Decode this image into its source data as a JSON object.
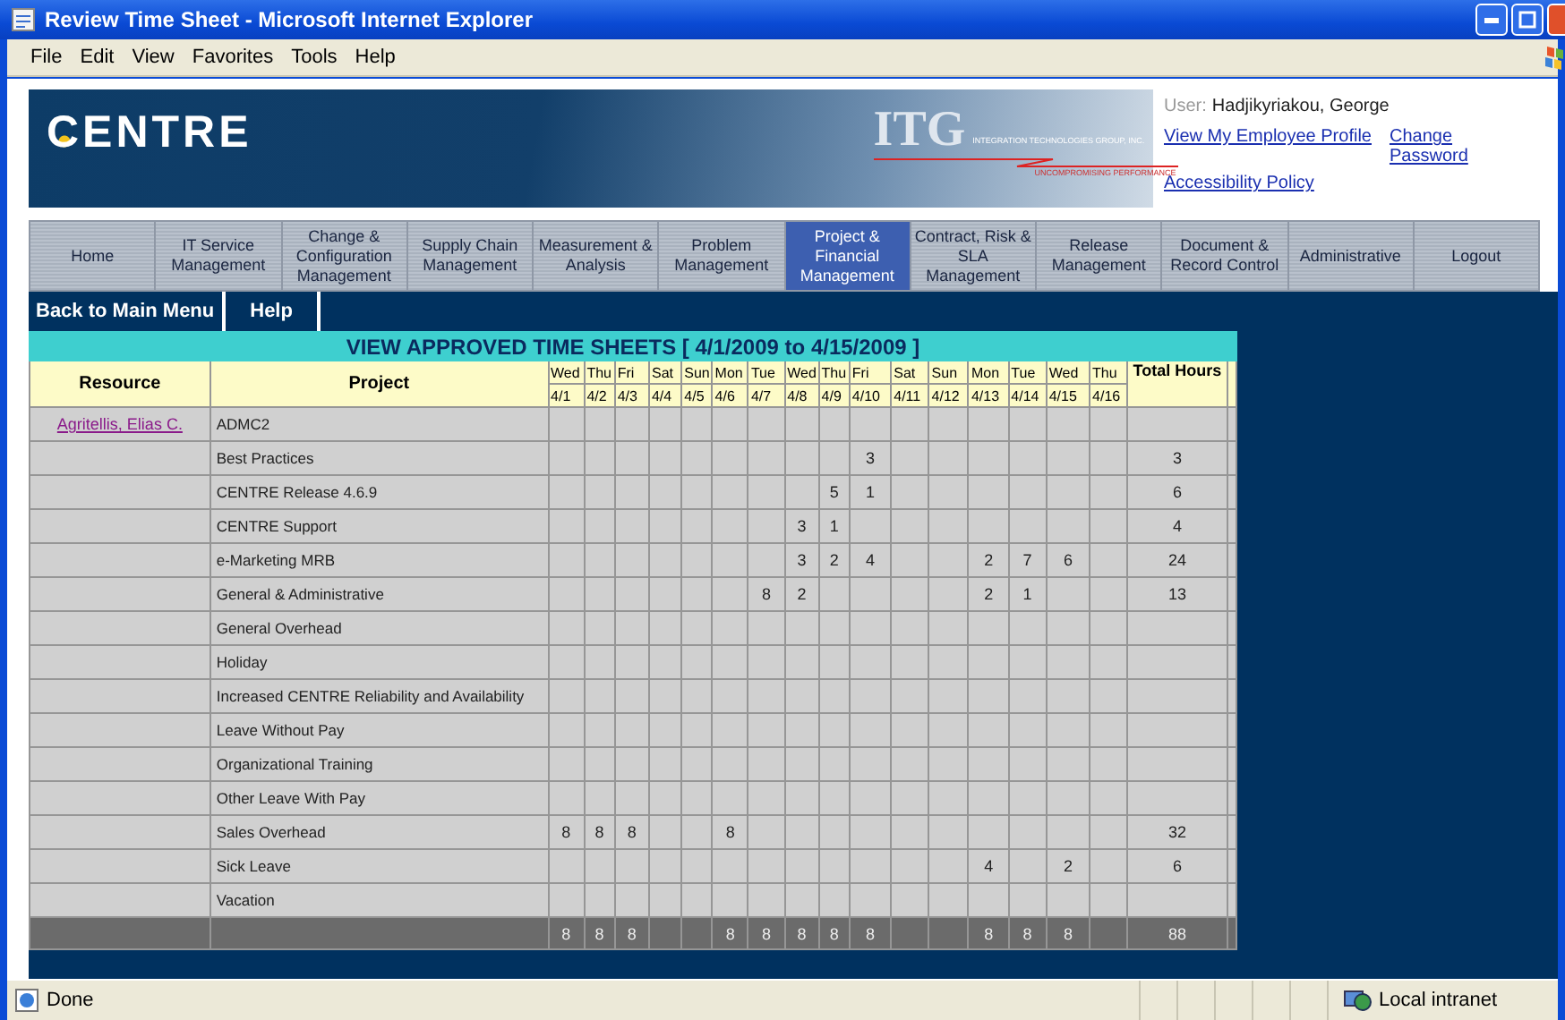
{
  "window": {
    "title": "Review Time Sheet - Microsoft Internet Explorer"
  },
  "menu": [
    "File",
    "Edit",
    "View",
    "Favorites",
    "Tools",
    "Help"
  ],
  "banner": {
    "logo": "CENTRE",
    "partner_logo": "ITG",
    "partner_name": "INTEGRATION TECHNOLOGIES GROUP, INC.",
    "partner_tagline": "UNCOMPROMISING PERFORMANCE"
  },
  "user": {
    "label": "User:",
    "name": "Hadjikyriakou, George",
    "links": [
      "View My Employee Profile",
      "Change Password",
      "Accessibility Policy"
    ]
  },
  "nav": [
    {
      "label": "Home",
      "selected": false
    },
    {
      "label": "IT Service Management",
      "selected": false
    },
    {
      "label": "Change & Configuration Management",
      "selected": false
    },
    {
      "label": "Supply Chain Management",
      "selected": false
    },
    {
      "label": "Measurement & Analysis",
      "selected": false
    },
    {
      "label": "Problem Management",
      "selected": false
    },
    {
      "label": "Project & Financial Management",
      "selected": true
    },
    {
      "label": "Contract, Risk & SLA Management",
      "selected": false
    },
    {
      "label": "Release Management",
      "selected": false
    },
    {
      "label": "Document & Record Control",
      "selected": false
    },
    {
      "label": "Administrative",
      "selected": false
    },
    {
      "label": "Logout",
      "selected": false
    }
  ],
  "sub_nav": [
    "Back to Main Menu",
    "Help"
  ],
  "table": {
    "title": "VIEW APPROVED TIME SHEETS [ 4/1/2009 to 4/15/2009 ]",
    "columns": {
      "resource": "Resource",
      "project": "Project",
      "total": "Total Hours"
    },
    "days": [
      {
        "day": "Wed",
        "date": "4/1"
      },
      {
        "day": "Thu",
        "date": "4/2"
      },
      {
        "day": "Fri",
        "date": "4/3"
      },
      {
        "day": "Sat",
        "date": "4/4"
      },
      {
        "day": "Sun",
        "date": "4/5"
      },
      {
        "day": "Mon",
        "date": "4/6"
      },
      {
        "day": "Tue",
        "date": "4/7"
      },
      {
        "day": "Wed",
        "date": "4/8"
      },
      {
        "day": "Thu",
        "date": "4/9"
      },
      {
        "day": "Fri",
        "date": "4/10"
      },
      {
        "day": "Sat",
        "date": "4/11"
      },
      {
        "day": "Sun",
        "date": "4/12"
      },
      {
        "day": "Mon",
        "date": "4/13"
      },
      {
        "day": "Tue",
        "date": "4/14"
      },
      {
        "day": "Wed",
        "date": "4/15"
      },
      {
        "day": "Thu",
        "date": "4/16"
      }
    ],
    "rows": [
      {
        "resource": "Agritellis, Elias C.",
        "project": "ADMC2",
        "hours": [
          {
            "kind": "empty"
          },
          {
            "kind": "empty"
          },
          {
            "kind": "empty"
          },
          {
            "kind": "empty"
          },
          {
            "kind": "empty"
          },
          {
            "kind": "empty"
          },
          {
            "kind": "empty"
          },
          {
            "kind": "empty"
          },
          {
            "kind": "empty"
          },
          {
            "kind": "empty"
          },
          {
            "kind": "empty"
          },
          {
            "kind": "empty"
          },
          {
            "kind": "empty"
          },
          {
            "kind": "empty"
          },
          {
            "kind": "empty"
          },
          {
            "kind": "empty"
          }
        ]
      },
      {
        "project": "Best Practices",
        "hours": [
          {
            "kind": "empty"
          },
          {
            "kind": "empty"
          },
          {
            "kind": "empty"
          },
          {
            "kind": "empty"
          },
          {
            "kind": "empty"
          },
          {
            "kind": "empty"
          },
          {
            "kind": "empty"
          },
          {
            "kind": "empty"
          },
          {
            "kind": "empty"
          },
          {
            "kind": "entry",
            "value": "3"
          },
          {
            "kind": "empty"
          },
          {
            "kind": "empty"
          },
          {
            "kind": "empty"
          },
          {
            "kind": "empty"
          },
          {
            "kind": "empty"
          },
          {
            "kind": "empty"
          }
        ],
        "total": "3"
      },
      {
        "project": "CENTRE Release 4.6.9",
        "hours": [
          {
            "kind": "empty"
          },
          {
            "kind": "empty"
          },
          {
            "kind": "empty"
          },
          {
            "kind": "empty"
          },
          {
            "kind": "empty"
          },
          {
            "kind": "empty"
          },
          {
            "kind": "empty"
          },
          {
            "kind": "empty"
          },
          {
            "kind": "entry",
            "value": "5"
          },
          {
            "kind": "entry",
            "value": "1"
          },
          {
            "kind": "empty"
          },
          {
            "kind": "empty"
          },
          {
            "kind": "empty"
          },
          {
            "kind": "empty"
          },
          {
            "kind": "empty"
          },
          {
            "kind": "empty"
          }
        ],
        "total": "6"
      },
      {
        "project": "CENTRE Support",
        "hours": [
          {
            "kind": "empty"
          },
          {
            "kind": "empty"
          },
          {
            "kind": "empty"
          },
          {
            "kind": "empty"
          },
          {
            "kind": "empty"
          },
          {
            "kind": "empty"
          },
          {
            "kind": "empty"
          },
          {
            "kind": "entry",
            "value": "3"
          },
          {
            "kind": "entry",
            "value": "1"
          },
          {
            "kind": "empty"
          },
          {
            "kind": "empty"
          },
          {
            "kind": "empty"
          },
          {
            "kind": "empty"
          },
          {
            "kind": "empty"
          },
          {
            "kind": "empty"
          },
          {
            "kind": "empty"
          }
        ],
        "total": "4"
      },
      {
        "project": "e-Marketing MRB",
        "hours": [
          {
            "kind": "empty"
          },
          {
            "kind": "empty"
          },
          {
            "kind": "empty"
          },
          {
            "kind": "empty"
          },
          {
            "kind": "empty"
          },
          {
            "kind": "empty"
          },
          {
            "kind": "empty"
          },
          {
            "kind": "entry",
            "value": "3"
          },
          {
            "kind": "entry",
            "value": "2"
          },
          {
            "kind": "entry",
            "value": "4"
          },
          {
            "kind": "empty"
          },
          {
            "kind": "empty"
          },
          {
            "kind": "entry",
            "value": "2"
          },
          {
            "kind": "entry",
            "value": "7"
          },
          {
            "kind": "entry",
            "value": "6"
          },
          {
            "kind": "empty"
          }
        ],
        "total": "24"
      },
      {
        "project": "General & Administrative",
        "hours": [
          {
            "kind": "empty"
          },
          {
            "kind": "empty"
          },
          {
            "kind": "empty"
          },
          {
            "kind": "empty"
          },
          {
            "kind": "empty"
          },
          {
            "kind": "empty"
          },
          {
            "kind": "entry",
            "value": "8"
          },
          {
            "kind": "entry",
            "value": "2"
          },
          {
            "kind": "empty"
          },
          {
            "kind": "empty"
          },
          {
            "kind": "empty"
          },
          {
            "kind": "empty"
          },
          {
            "kind": "entry",
            "value": "2"
          },
          {
            "kind": "entry",
            "value": "1"
          },
          {
            "kind": "empty"
          },
          {
            "kind": "empty"
          }
        ],
        "total": "13"
      },
      {
        "project": "General Overhead",
        "hours": [
          {
            "kind": "empty"
          },
          {
            "kind": "empty"
          },
          {
            "kind": "empty"
          },
          {
            "kind": "empty"
          },
          {
            "kind": "empty"
          },
          {
            "kind": "empty"
          },
          {
            "kind": "empty"
          },
          {
            "kind": "empty"
          },
          {
            "kind": "empty"
          },
          {
            "kind": "empty"
          },
          {
            "kind": "empty"
          },
          {
            "kind": "empty"
          },
          {
            "kind": "empty"
          },
          {
            "kind": "empty"
          },
          {
            "kind": "empty"
          },
          {
            "kind": "empty"
          }
        ]
      },
      {
        "project": "Holiday",
        "hours": [
          {
            "kind": "empty"
          },
          {
            "kind": "empty"
          },
          {
            "kind": "empty"
          },
          {
            "kind": "empty"
          },
          {
            "kind": "empty"
          },
          {
            "kind": "empty"
          },
          {
            "kind": "empty"
          },
          {
            "kind": "empty"
          },
          {
            "kind": "empty"
          },
          {
            "kind": "empty"
          },
          {
            "kind": "empty"
          },
          {
            "kind": "empty"
          },
          {
            "kind": "empty"
          },
          {
            "kind": "empty"
          },
          {
            "kind": "empty"
          },
          {
            "kind": "empty"
          }
        ]
      },
      {
        "project": "Increased CENTRE Reliability and Availability",
        "hours": [
          {
            "kind": "empty"
          },
          {
            "kind": "empty"
          },
          {
            "kind": "empty"
          },
          {
            "kind": "empty"
          },
          {
            "kind": "empty"
          },
          {
            "kind": "empty"
          },
          {
            "kind": "empty"
          },
          {
            "kind": "empty"
          },
          {
            "kind": "empty"
          },
          {
            "kind": "empty"
          },
          {
            "kind": "empty"
          },
          {
            "kind": "empty"
          },
          {
            "kind": "empty"
          },
          {
            "kind": "empty"
          },
          {
            "kind": "empty"
          },
          {
            "kind": "empty"
          }
        ]
      },
      {
        "project": "Leave Without Pay",
        "hours": [
          {
            "kind": "empty"
          },
          {
            "kind": "empty"
          },
          {
            "kind": "empty"
          },
          {
            "kind": "empty"
          },
          {
            "kind": "empty"
          },
          {
            "kind": "empty"
          },
          {
            "kind": "empty"
          },
          {
            "kind": "empty"
          },
          {
            "kind": "empty"
          },
          {
            "kind": "empty"
          },
          {
            "kind": "empty"
          },
          {
            "kind": "empty"
          },
          {
            "kind": "empty"
          },
          {
            "kind": "empty"
          },
          {
            "kind": "empty"
          },
          {
            "kind": "empty"
          }
        ]
      },
      {
        "project": "Organizational Training",
        "hours": [
          {
            "kind": "empty"
          },
          {
            "kind": "empty"
          },
          {
            "kind": "empty"
          },
          {
            "kind": "empty"
          },
          {
            "kind": "empty"
          },
          {
            "kind": "empty"
          },
          {
            "kind": "empty"
          },
          {
            "kind": "empty"
          },
          {
            "kind": "empty"
          },
          {
            "kind": "empty"
          },
          {
            "kind": "empty"
          },
          {
            "kind": "empty"
          },
          {
            "kind": "empty"
          },
          {
            "kind": "empty"
          },
          {
            "kind": "empty"
          },
          {
            "kind": "empty"
          }
        ]
      },
      {
        "project": "Other Leave With Pay",
        "hours": [
          {
            "kind": "empty"
          },
          {
            "kind": "empty"
          },
          {
            "kind": "empty"
          },
          {
            "kind": "empty"
          },
          {
            "kind": "empty"
          },
          {
            "kind": "empty"
          },
          {
            "kind": "empty"
          },
          {
            "kind": "empty"
          },
          {
            "kind": "empty"
          },
          {
            "kind": "empty"
          },
          {
            "kind": "empty"
          },
          {
            "kind": "empty"
          },
          {
            "kind": "empty"
          },
          {
            "kind": "empty"
          },
          {
            "kind": "empty"
          },
          {
            "kind": "empty"
          }
        ]
      },
      {
        "project": "Sales Overhead",
        "hours": [
          {
            "kind": "entry",
            "value": "8"
          },
          {
            "kind": "entry",
            "value": "8"
          },
          {
            "kind": "entry",
            "value": "8"
          },
          {
            "kind": "empty"
          },
          {
            "kind": "empty"
          },
          {
            "kind": "entry",
            "value": "8"
          },
          {
            "kind": "empty"
          },
          {
            "kind": "empty"
          },
          {
            "kind": "empty"
          },
          {
            "kind": "empty"
          },
          {
            "kind": "empty"
          },
          {
            "kind": "empty"
          },
          {
            "kind": "empty"
          },
          {
            "kind": "empty"
          },
          {
            "kind": "empty"
          },
          {
            "kind": "empty"
          }
        ],
        "total": "32"
      },
      {
        "project": "Sick Leave",
        "hours": [
          {
            "kind": "empty"
          },
          {
            "kind": "empty"
          },
          {
            "kind": "empty"
          },
          {
            "kind": "empty"
          },
          {
            "kind": "empty"
          },
          {
            "kind": "empty"
          },
          {
            "kind": "empty"
          },
          {
            "kind": "empty"
          },
          {
            "kind": "empty"
          },
          {
            "kind": "empty"
          },
          {
            "kind": "empty"
          },
          {
            "kind": "empty"
          },
          {
            "kind": "entry",
            "value": "4"
          },
          {
            "kind": "empty"
          },
          {
            "kind": "entry",
            "value": "2"
          },
          {
            "kind": "empty"
          }
        ],
        "total": "6"
      },
      {
        "project": "Vacation",
        "hours": [
          {
            "kind": "empty"
          },
          {
            "kind": "empty"
          },
          {
            "kind": "empty"
          },
          {
            "kind": "empty"
          },
          {
            "kind": "empty"
          },
          {
            "kind": "empty"
          },
          {
            "kind": "empty"
          },
          {
            "kind": "empty"
          },
          {
            "kind": "empty"
          },
          {
            "kind": "empty"
          },
          {
            "kind": "empty"
          },
          {
            "kind": "empty"
          },
          {
            "kind": "empty"
          },
          {
            "kind": "empty"
          },
          {
            "kind": "empty"
          },
          {
            "kind": "empty"
          }
        ]
      }
    ],
    "totals": {
      "hours": [
        {
          "kind": "entry",
          "value": "8"
        },
        {
          "kind": "entry",
          "value": "8"
        },
        {
          "kind": "entry",
          "value": "8"
        },
        {
          "kind": "empty"
        },
        {
          "kind": "empty"
        },
        {
          "kind": "entry",
          "value": "8"
        },
        {
          "kind": "entry",
          "value": "8"
        },
        {
          "kind": "entry",
          "value": "8"
        },
        {
          "kind": "entry",
          "value": "8"
        },
        {
          "kind": "entry",
          "value": "8"
        },
        {
          "kind": "empty"
        },
        {
          "kind": "empty"
        },
        {
          "kind": "entry",
          "value": "8"
        },
        {
          "kind": "entry",
          "value": "8"
        },
        {
          "kind": "entry",
          "value": "8"
        },
        {
          "kind": "empty"
        }
      ],
      "total": "88"
    }
  },
  "status_bar": {
    "status": "Done",
    "zone": "Local intranet"
  }
}
